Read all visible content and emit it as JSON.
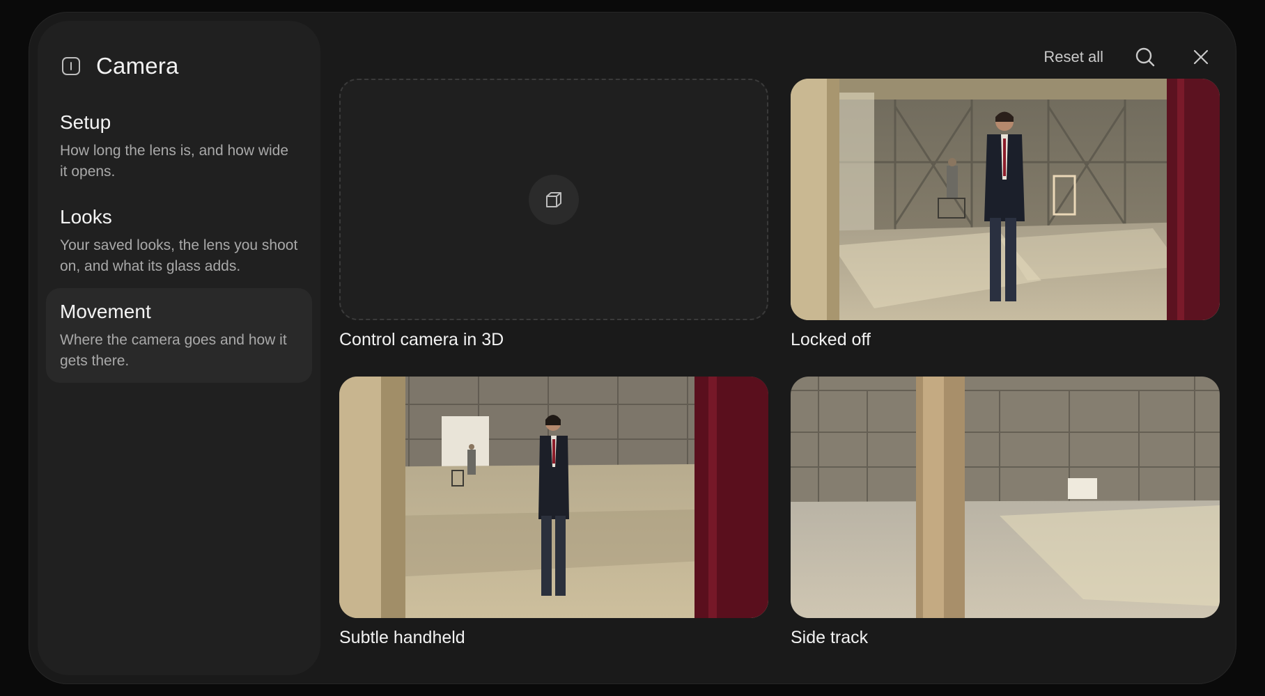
{
  "window": {
    "title": "Camera",
    "reset_label": "Reset all"
  },
  "icons": {
    "panel": "sidebar-panel-icon",
    "search": "search-icon",
    "close": "close-icon",
    "cube": "cube-3d-icon"
  },
  "sidebar": {
    "items": [
      {
        "title": "Setup",
        "description": "How long the lens is, and how wide it opens.",
        "active": false
      },
      {
        "title": "Looks",
        "description": "Your saved looks, the lens you shoot on, and what its glass adds.",
        "active": false
      },
      {
        "title": "Movement",
        "description": "Where the camera goes and how it gets there.",
        "active": true
      }
    ]
  },
  "cards": [
    {
      "label": "Control camera in 3D"
    },
    {
      "label": "Locked off"
    },
    {
      "label": "Subtle handheld"
    },
    {
      "label": "Side track"
    }
  ],
  "colors": {
    "background": "#0a0a0a",
    "window": "#1a1a1a",
    "sidebar": "#202020",
    "active_item": "#292929"
  }
}
